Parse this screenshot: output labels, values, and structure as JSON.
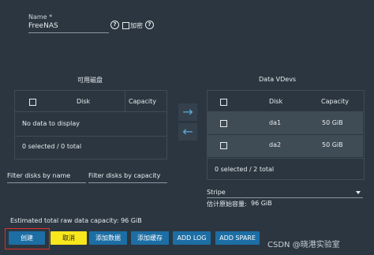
{
  "form": {
    "name_label": "Name *",
    "name_value": "FreeNAS",
    "encrypt_label": "加密"
  },
  "left_panel": {
    "title": "可用磁盘",
    "columns": [
      "Disk",
      "Capacity"
    ],
    "empty_text": "No data to display",
    "footer": "0 selected / 0 total",
    "filter_name_placeholder": "Filter disks by name",
    "filter_capacity_placeholder": "Filter disks by capacity"
  },
  "right_panel": {
    "title": "Data VDevs",
    "columns": [
      "Disk",
      "Capacity"
    ],
    "rows": [
      {
        "disk": "da1",
        "capacity": "50 GiB"
      },
      {
        "disk": "da2",
        "capacity": "50 GiB"
      }
    ],
    "footer": "0 selected / 2 total",
    "layout_value": "Stripe",
    "estimated_label": "估计原始容量:",
    "estimated_value": "96 GiB"
  },
  "summary": {
    "raw_capacity": "Estimated total raw data capacity: 96 GiB"
  },
  "buttons": {
    "create": "创建",
    "cancel": "取消",
    "add_data": "添加数据",
    "add_cache": "添加缓存",
    "add_log": "ADD LOG",
    "add_spare": "ADD SPARE"
  },
  "icons": {
    "move_right": "arrow-right-icon",
    "move_left": "arrow-left-icon"
  },
  "watermark": "CSDN @晓港实验室",
  "colors": {
    "background": "#2b3640",
    "primary": "#1c6ea4",
    "cancel": "#f8e71c",
    "arrow": "#5ea8dc",
    "highlight": "#e0302a"
  }
}
